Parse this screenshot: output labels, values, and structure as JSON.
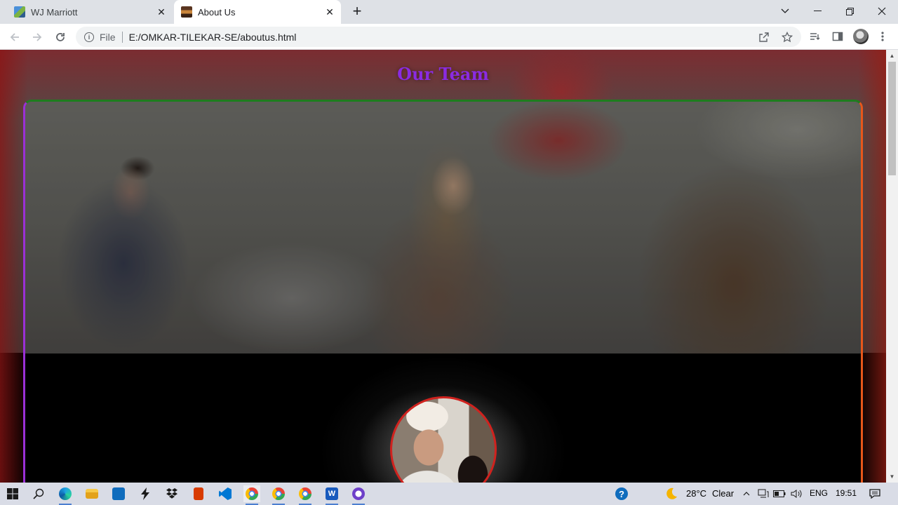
{
  "browser": {
    "tabs": [
      {
        "title": "WJ Marriott",
        "active": false
      },
      {
        "title": "About Us",
        "active": true
      }
    ],
    "new_tab_symbol": "+",
    "address": {
      "scheme_label": "File",
      "url": "E:/OMKAR-TILEKAR-SE/aboutus.html"
    }
  },
  "page": {
    "heading": "Our Team",
    "heading_color": "#8a2be2",
    "frame_border_colors": {
      "top": "#1e7d1e",
      "left": "#9b30d6",
      "right": "#e8561a"
    },
    "member_photo_border": "#d0221e"
  },
  "taskbar": {
    "weather": {
      "temperature": "28°C",
      "condition": "Clear"
    },
    "language": "ENG",
    "time": "19:51"
  },
  "icons": {
    "tab_close": "close-icon",
    "back": "arrow-left-icon",
    "forward": "arrow-right-icon",
    "reload": "reload-icon",
    "info": "info-icon",
    "share": "share-icon",
    "bookmark": "star-icon",
    "reading_list": "reading-list-icon",
    "side_panel": "side-panel-icon",
    "menu": "more-vert-icon"
  }
}
